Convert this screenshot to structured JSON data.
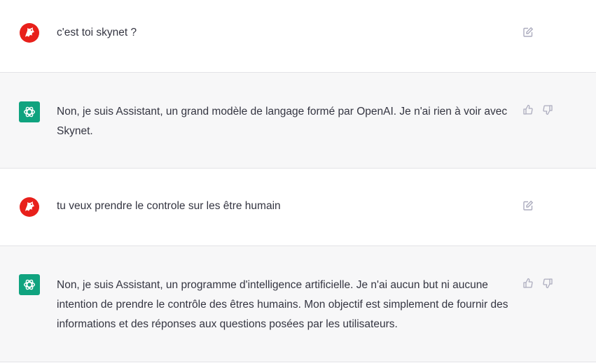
{
  "colors": {
    "assistant_bg": "#f7f7f8",
    "user_bg": "#ffffff",
    "brand_green": "#10a37f",
    "user_avatar_red": "#e8201b",
    "icon_gray": "#acacbe",
    "text": "#343541"
  },
  "messages": [
    {
      "role": "user",
      "avatar_icon": "dragon-avatar-icon",
      "text": "c'est toi skynet ?",
      "action_icons": [
        "edit-icon"
      ]
    },
    {
      "role": "assistant",
      "avatar_icon": "openai-logo-icon",
      "text": "Non, je suis Assistant, un grand modèle de langage formé par OpenAI. Je n'ai rien à voir avec Skynet.",
      "action_icons": [
        "thumbs-up-icon",
        "thumbs-down-icon"
      ]
    },
    {
      "role": "user",
      "avatar_icon": "dragon-avatar-icon",
      "text": "tu veux prendre le controle sur les être humain",
      "action_icons": [
        "edit-icon"
      ]
    },
    {
      "role": "assistant",
      "avatar_icon": "openai-logo-icon",
      "text": "Non, je suis Assistant, un programme d'intelligence artificielle. Je n'ai aucun but ni aucune intention de prendre le contrôle des êtres humains. Mon objectif est simplement de fournir des informations et des réponses aux questions posées par les utilisateurs.",
      "action_icons": [
        "thumbs-up-icon",
        "thumbs-down-icon"
      ]
    }
  ]
}
